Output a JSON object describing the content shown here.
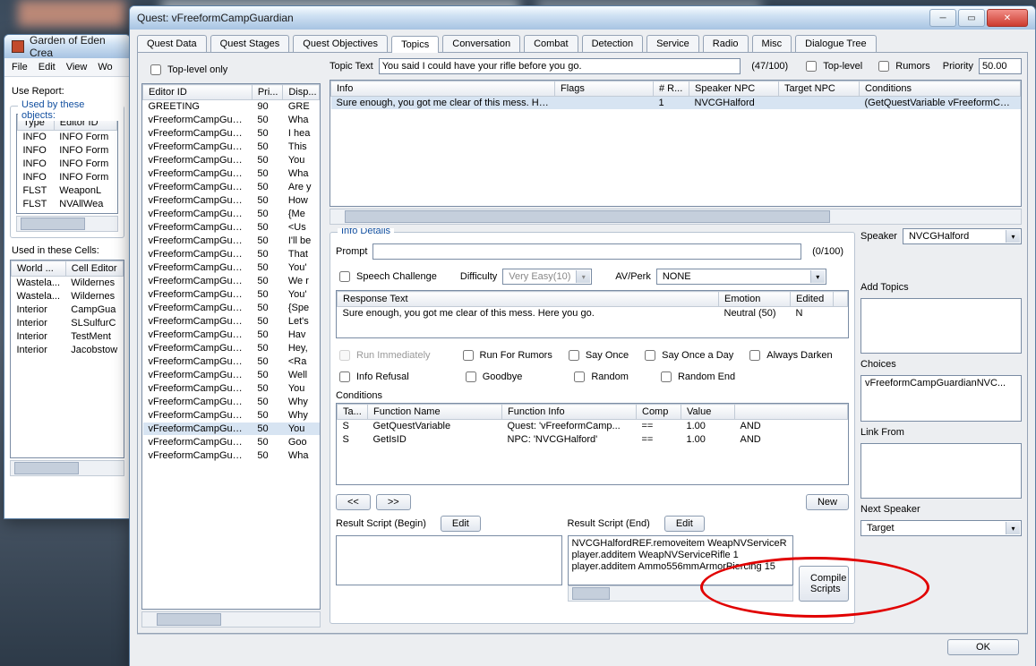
{
  "geck": {
    "title": "Garden of Eden Crea",
    "menus": [
      "File",
      "Edit",
      "View",
      "Wo"
    ],
    "useReport": "Use Report:",
    "usedByObjects": {
      "title": "Used by these objects:",
      "cols": [
        "Type",
        "Editor ID"
      ],
      "rows": [
        [
          "INFO",
          "INFO Form"
        ],
        [
          "INFO",
          "INFO Form"
        ],
        [
          "INFO",
          "INFO Form"
        ],
        [
          "INFO",
          "INFO Form"
        ],
        [
          "FLST",
          "WeaponL"
        ],
        [
          "FLST",
          "NVAllWea"
        ]
      ]
    },
    "usedInCells": {
      "title": "Used in these Cells:",
      "cols": [
        "World ...",
        "Cell Editor"
      ],
      "rows": [
        [
          "Wastela...",
          "Wildernes"
        ],
        [
          "Wastela...",
          "Wildernes"
        ],
        [
          "Interior",
          "CampGua"
        ],
        [
          "Interior",
          "SLSulfurC"
        ],
        [
          "Interior",
          "TestMent"
        ],
        [
          "Interior",
          "Jacobstow"
        ]
      ]
    }
  },
  "quest": {
    "title": "Quest: vFreeformCampGuardian",
    "tabs": [
      "Quest Data",
      "Quest Stages",
      "Quest Objectives",
      "Topics",
      "Conversation",
      "Combat",
      "Detection",
      "Service",
      "Radio",
      "Misc",
      "Dialogue Tree"
    ],
    "activeTab": 3,
    "topLevelOnly": "Top-level only",
    "topicListCols": [
      "Editor ID",
      "Pri...",
      "Disp..."
    ],
    "topicRows": [
      [
        "GREETING",
        "90",
        "GRE"
      ],
      [
        "vFreeformCampGuardi...",
        "50",
        "Wha"
      ],
      [
        "vFreeformCampGuardi...",
        "50",
        "I hea"
      ],
      [
        "vFreeformCampGuardi...",
        "50",
        "This"
      ],
      [
        "vFreeformCampGuardi...",
        "50",
        "You"
      ],
      [
        "vFreeformCampGuardi...",
        "50",
        "Wha"
      ],
      [
        "vFreeformCampGuardi...",
        "50",
        "Are y"
      ],
      [
        "vFreeformCampGuardi...",
        "50",
        "How"
      ],
      [
        "vFreeformCampGuardi...",
        "50",
        "{Me"
      ],
      [
        "vFreeformCampGuardi...",
        "50",
        "<Us"
      ],
      [
        "vFreeformCampGuardi...",
        "50",
        "I'll be"
      ],
      [
        "vFreeformCampGuardi...",
        "50",
        "That"
      ],
      [
        "vFreeformCampGuardi...",
        "50",
        "You'"
      ],
      [
        "vFreeformCampGuardi...",
        "50",
        "We r"
      ],
      [
        "vFreeformCampGuardi...",
        "50",
        "You'"
      ],
      [
        "vFreeformCampGuardi...",
        "50",
        "{Spe"
      ],
      [
        "vFreeformCampGuardi...",
        "50",
        "Let's"
      ],
      [
        "vFreeformCampGuardi...",
        "50",
        "Hav"
      ],
      [
        "vFreeformCampGuardi...",
        "50",
        "Hey,"
      ],
      [
        "vFreeformCampGuardi...",
        "50",
        "<Ra"
      ],
      [
        "vFreeformCampGuardi...",
        "50",
        "Well"
      ],
      [
        "vFreeformCampGuardi...",
        "50",
        "You"
      ],
      [
        "vFreeformCampGuardi...",
        "50",
        "Why"
      ],
      [
        "vFreeformCampGuardi...",
        "50",
        "Why"
      ],
      [
        "vFreeformCampGuardi...",
        "50",
        "You"
      ],
      [
        "vFreeformCampGuardi...",
        "50",
        "Goo"
      ],
      [
        "vFreeformCampGuardi...",
        "50",
        "Wha"
      ]
    ],
    "selectedTopicRow": 24,
    "topicText": {
      "label": "Topic Text",
      "value": "You said I could have your rifle before you go."
    },
    "counter": "(47/100)",
    "topLevel": "Top-level",
    "rumors": "Rumors",
    "priority": {
      "label": "Priority",
      "value": "50.00"
    },
    "infoCols": [
      "Info",
      "Flags",
      "# R...",
      "Speaker NPC",
      "Target NPC",
      "Conditions"
    ],
    "infoRows": [
      [
        "Sure enough, you got me clear of this mess. Here ...",
        "",
        "1",
        "NVCGHalford",
        "",
        "(GetQuestVariable vFreeformCampG"
      ]
    ],
    "infoDetails": {
      "title": "Info Details",
      "prompt": "Prompt",
      "promptCounter": "(0/100)",
      "speaker": {
        "label": "Speaker",
        "value": "NVCGHalford"
      },
      "speechChallenge": "Speech Challenge",
      "difficulty": {
        "label": "Difficulty",
        "value": "Very Easy(10)"
      },
      "avperk": {
        "label": "AV/Perk",
        "value": "NONE"
      },
      "respCols": [
        "Response Text",
        "Emotion",
        "Edited"
      ],
      "respRows": [
        [
          "Sure enough, you got me clear of this mess. Here you go.",
          "Neutral (50)",
          "N"
        ]
      ],
      "flags": {
        "runImmediately": "Run Immediately",
        "runForRumors": "Run For Rumors",
        "sayOnce": "Say Once",
        "sayOnceDay": "Say Once a Day",
        "alwaysDarken": "Always Darken",
        "infoRefusal": "Info Refusal",
        "goodbye": "Goodbye",
        "random": "Random",
        "randomEnd": "Random End"
      },
      "conditions": {
        "label": "Conditions",
        "cols": [
          "Ta...",
          "Function Name",
          "Function Info",
          "Comp",
          "Value",
          ""
        ],
        "rows": [
          [
            "S",
            "GetQuestVariable",
            "Quest: 'vFreeformCamp...",
            "==",
            "1.00",
            "AND"
          ],
          [
            "S",
            "GetIsID",
            "NPC: 'NVCGHalford'",
            "==",
            "1.00",
            "AND"
          ]
        ]
      },
      "nav": {
        "prev": "<<",
        "next": ">>",
        "new": "New"
      },
      "resultBegin": "Result Script (Begin)",
      "resultEnd": "Result Script (End)",
      "edit": "Edit",
      "compile": "Compile Scripts",
      "endScript": [
        "NVCGHalfordREF.removeitem WeapNVServiceR",
        "player.additem WeapNVServiceRifle 1",
        "player.additem Ammo556mmArmorPiercing 15"
      ]
    },
    "sidePanels": {
      "addTopics": "Add Topics",
      "choices": "Choices",
      "choiceRow": "vFreeformCampGuardianNVC...",
      "linkFrom": "Link From",
      "nextSpeaker": {
        "label": "Next Speaker",
        "value": "Target"
      }
    },
    "ok": "OK"
  }
}
